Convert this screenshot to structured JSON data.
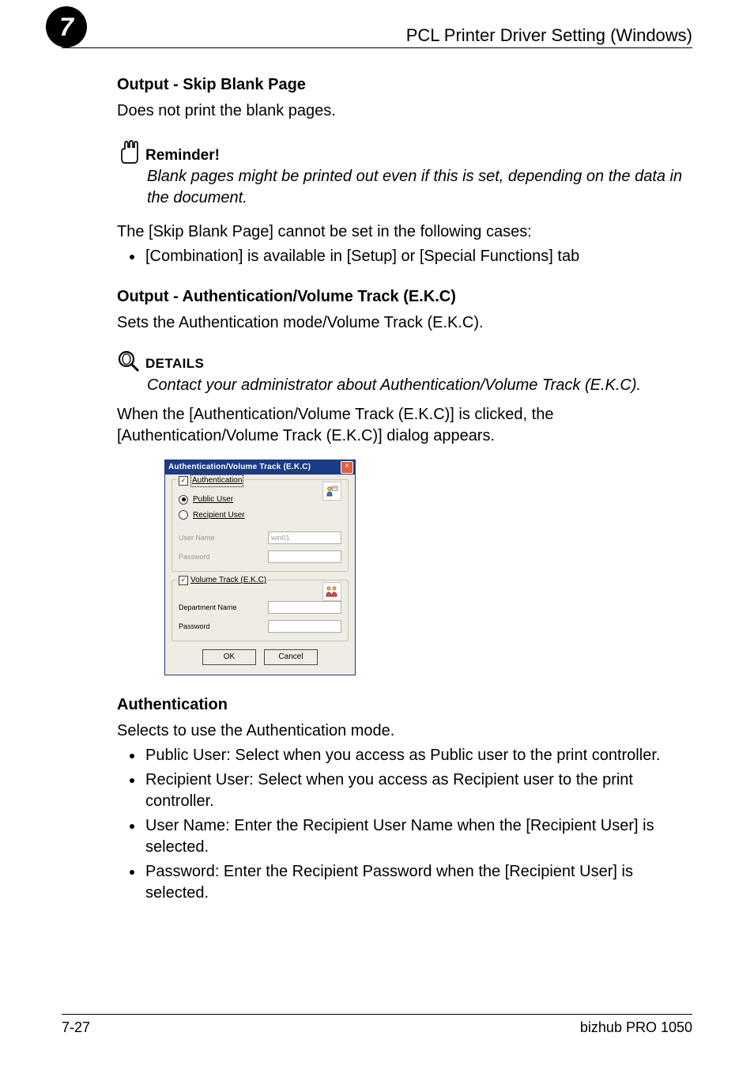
{
  "header": {
    "chapter_number": "7",
    "chapter_title": "PCL Printer Driver Setting (Windows)"
  },
  "section_skip_blank": {
    "title": "Output - Skip Blank Page",
    "body": "Does not print the blank pages."
  },
  "reminder": {
    "label": "Reminder!",
    "body": "Blank pages might be printed out even if this is set, depending on the data in the document."
  },
  "skip_blank_note": {
    "intro": "The [Skip Blank Page] cannot be set in the following cases:",
    "bullets": [
      "[Combination] is available in [Setup] or [Special Functions] tab"
    ]
  },
  "section_auth": {
    "title": "Output - Authentication/Volume Track (E.K.C)",
    "body": "Sets the Authentication mode/Volume Track (E.K.C)."
  },
  "details": {
    "label": "DETAILS",
    "body": "Contact your administrator about Authentication/Volume Track (E.K.C)."
  },
  "auth_paragraph": "When the [Authentication/Volume Track (E.K.C)] is clicked, the [Authentication/Volume Track (E.K.C)] dialog appears.",
  "dialog": {
    "title": "Authentication/Volume Track (E.K.C)",
    "close_glyph": "×",
    "auth_group": {
      "check": "✓",
      "legend": "Authentication",
      "public_user": "Public User",
      "recipient_user": "Recipient User",
      "user_name_label": "User Name",
      "user_name_value": "win01",
      "password_label": "Password",
      "password_value": ""
    },
    "volume_group": {
      "check": "✓",
      "legend": "Volume Track (E.K.C)",
      "dept_label": "Department Name",
      "dept_value": "",
      "password_label": "Password",
      "password_value": ""
    },
    "ok_label": "OK",
    "cancel_label": "Cancel"
  },
  "auth_section2": {
    "title": "Authentication",
    "intro": "Selects to use the Authentication mode.",
    "bullets": [
      "Public User: Select when you access as Public user to the print controller.",
      "Recipient User: Select when you access as Recipient user to the print controller.",
      "User Name: Enter the Recipient User Name when the [Recipient User] is selected.",
      "Password: Enter the Recipient Password when the [Recipient User] is selected."
    ]
  },
  "footer": {
    "page": "7-27",
    "product": "bizhub PRO 1050"
  }
}
